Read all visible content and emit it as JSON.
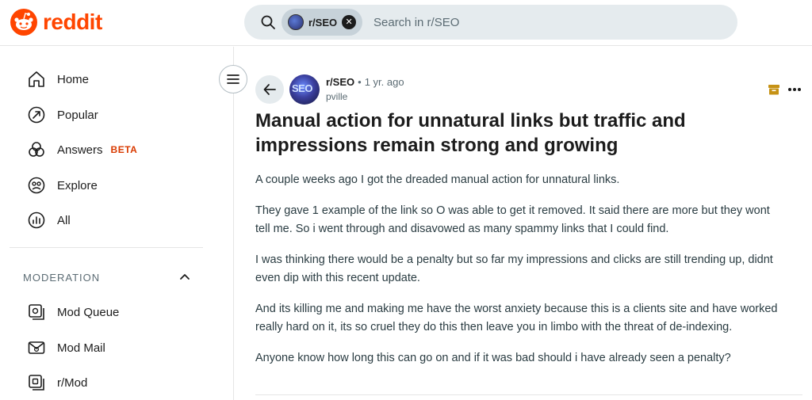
{
  "header": {
    "logo_text": "reddit",
    "search_chip": "r/SEO",
    "search_placeholder": "Search in r/SEO"
  },
  "sidebar": {
    "items": [
      {
        "label": "Home",
        "icon": "home-icon"
      },
      {
        "label": "Popular",
        "icon": "popular-icon"
      },
      {
        "label": "Answers",
        "icon": "answers-icon",
        "badge": "BETA"
      },
      {
        "label": "Explore",
        "icon": "explore-icon"
      },
      {
        "label": "All",
        "icon": "all-icon"
      }
    ],
    "section_title": "MODERATION",
    "mod_items": [
      {
        "label": "Mod Queue",
        "icon": "mod-queue-icon"
      },
      {
        "label": "Mod Mail",
        "icon": "mod-mail-icon"
      },
      {
        "label": "r/Mod",
        "icon": "mod-icon"
      }
    ]
  },
  "post": {
    "subreddit": "r/SEO",
    "separator": "•",
    "time": "1 yr. ago",
    "author": "pville",
    "avatar_text": "SEO",
    "title": "Manual action for unnatural links but traffic and impressions remain strong and growing",
    "paragraphs": [
      "A couple weeks ago I got the dreaded manual action for unnatural links.",
      "They gave 1 example of the link so O was able to get it removed. It said there are more but they wont tell me. So i went through and disavowed as many spammy links that I could find.",
      "I was thinking there would be a penalty but so far my impressions and clicks are still trending up, didnt even dip with this recent update.",
      "And its killing me and making me have the worst anxiety because this is a clients site and have worked really hard on it, its so cruel they do this then leave you in limbo with the threat of de-indexing.",
      "Anyone know how long this can go on and if it was bad should i have already seen a penalty?"
    ]
  },
  "colors": {
    "brand": "#ff4500",
    "beta": "#d93a00",
    "search_bg": "#e5ebee",
    "chip_bg": "#c7d2d9",
    "archive": "#c69214"
  }
}
